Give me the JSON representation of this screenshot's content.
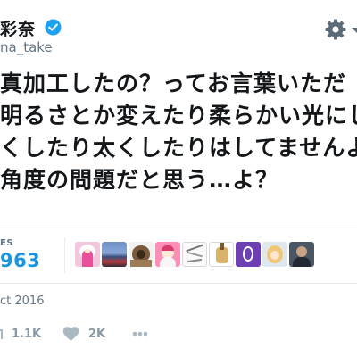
{
  "header": {
    "display_name": "彩奈",
    "handle": "na_take"
  },
  "tweet": {
    "lines": [
      "真加工したの？ってお言葉いただ",
      "明るさとか変えたり柔らかい光にし",
      "くしたり太くしたりはしてませんよー",
      "角度の問題だと思う…よ？"
    ]
  },
  "stats": {
    "likes_label": "ES",
    "likes_count": "963",
    "avatars": [
      "avatar-1",
      "avatar-2",
      "avatar-3",
      "avatar-4",
      "avatar-5",
      "avatar-6",
      "avatar-7",
      "avatar-8",
      "avatar-9"
    ]
  },
  "timestamp": "ct 2016",
  "actions": {
    "retweet_count": "1.1K",
    "like_count": "2K"
  },
  "colors": {
    "verified": "#1da1f2",
    "likes_count": "#1b95e0",
    "icon_gray": "#aab8c2",
    "text_gray": "#657786"
  }
}
